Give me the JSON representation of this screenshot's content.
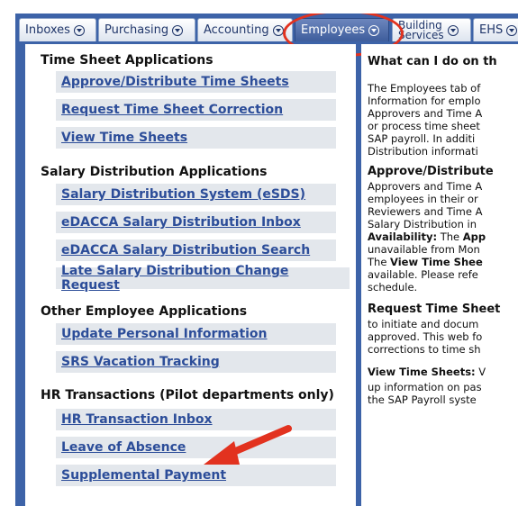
{
  "tabs": [
    {
      "label": "Inboxes"
    },
    {
      "label": "Purchasing"
    },
    {
      "label": "Accounting"
    },
    {
      "label": "Employees"
    },
    {
      "label_line1": "Building",
      "label_line2": "Services"
    },
    {
      "label": "EHS"
    }
  ],
  "left": {
    "categories": [
      {
        "title": "Time Sheet Applications",
        "links": [
          "Approve/Distribute Time Sheets",
          "Request Time Sheet Correction",
          "View Time Sheets"
        ]
      },
      {
        "title": "Salary Distribution Applications",
        "links": [
          "Salary Distribution System (eSDS)",
          "eDACCA Salary Distribution Inbox",
          "eDACCA Salary Distribution Search",
          "Late Salary Distribution Change Request"
        ]
      },
      {
        "title": "Other Employee Applications",
        "links": [
          "Update Personal Information",
          "SRS Vacation Tracking"
        ]
      },
      {
        "title": "HR Transactions (Pilot departments only)",
        "links": [
          "HR Transaction Inbox",
          "Leave of Absence",
          "Supplemental Payment"
        ]
      }
    ]
  },
  "right": {
    "heading": "What can I do on th",
    "intro": [
      "The Employees tab of",
      "Information for emplo",
      "Approvers and Time A",
      "or process time sheet",
      "SAP payroll. In additi",
      "Distribution informati"
    ],
    "approve_heading": "Approve/Distribute",
    "approve_lines": [
      "Approvers and Time A",
      "employees in their or",
      "Reviewers and Time A",
      "Salary Distribution in"
    ],
    "availability_label": "Availability:",
    "availability_rest": " The ",
    "availability_bold": "App",
    "unavail_line": "unavailable from Mon",
    "the_word": "The ",
    "view_time_bold": "View Time Shee",
    "available_lines": [
      "available. Please refe",
      "schedule."
    ],
    "request_heading": "Request Time Sheet",
    "request_lines": [
      "to initiate and docum",
      "approved. This web fo",
      "corrections to time sh"
    ],
    "view_heading": "View Time Sheets:",
    "view_heading_rest": " V",
    "view_lines": [
      "up information on pas",
      "the SAP Payroll syste"
    ]
  }
}
